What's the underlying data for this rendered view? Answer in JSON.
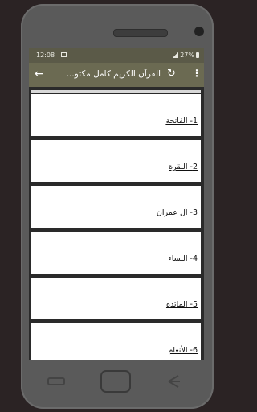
{
  "status": {
    "time": "12:08",
    "battery": "27%"
  },
  "appbar": {
    "title": "القرآن الكريم كامل مكتو...",
    "back_icon": "←",
    "refresh_icon": "↻",
    "more_icon": "⋮"
  },
  "list": {
    "items": [
      {
        "label": "1- الفاتحة"
      },
      {
        "label": "2- البقرة"
      },
      {
        "label": "3- آل عمران"
      },
      {
        "label": "4- النساء"
      },
      {
        "label": "5- المائدة"
      },
      {
        "label": "6- الأنعام"
      }
    ]
  }
}
